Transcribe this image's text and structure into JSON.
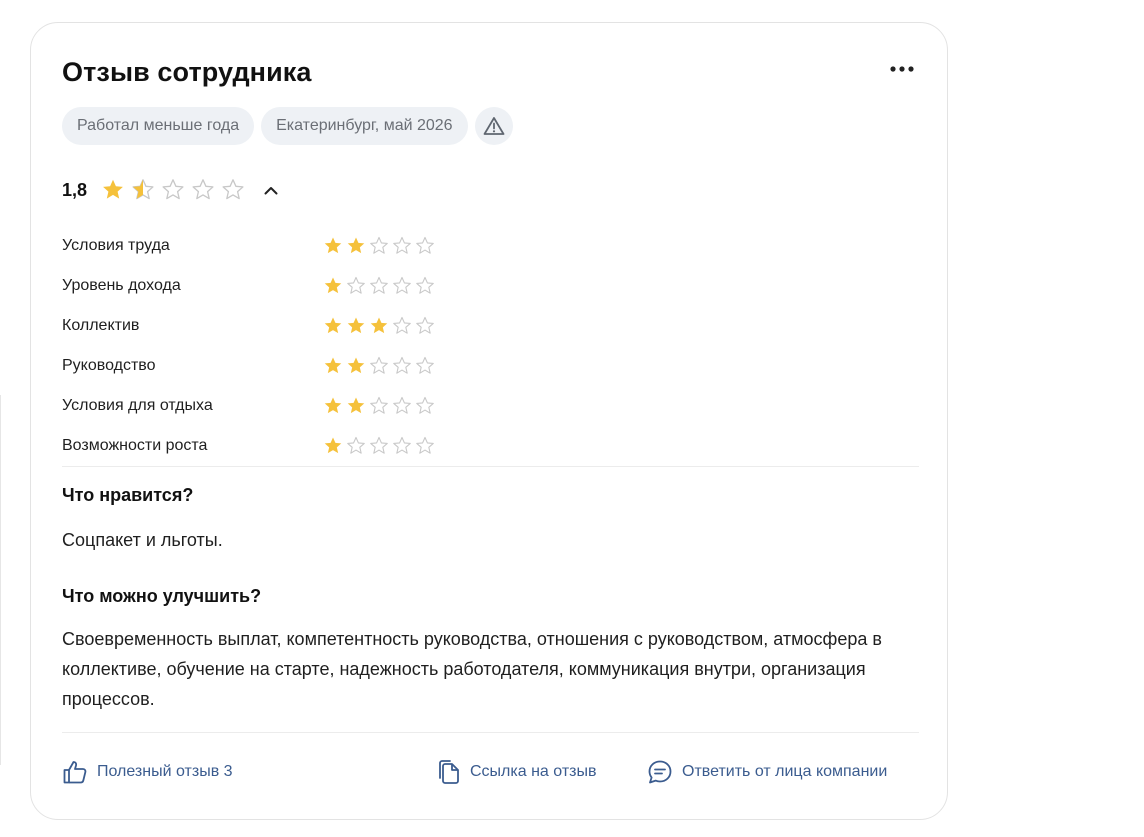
{
  "review": {
    "title": "Отзыв сотрудника",
    "menu_icon": "more-horizontal-icon",
    "chips": {
      "tenure": "Работал меньше года",
      "location_date": "Екатеринбург, май 2026",
      "report_icon": "warning-triangle-icon"
    },
    "overall": {
      "score": "1,8",
      "value": 1.8,
      "max": 5,
      "toggle_icon": "chevron-up-icon"
    },
    "ratings": [
      {
        "label": "Условия труда",
        "value": 2
      },
      {
        "label": "Уровень дохода",
        "value": 1
      },
      {
        "label": "Коллектив",
        "value": 3
      },
      {
        "label": "Руководство",
        "value": 2
      },
      {
        "label": "Условия для отдыха",
        "value": 2
      },
      {
        "label": "Возможности роста",
        "value": 1
      }
    ],
    "likes_heading": "Что нравится?",
    "likes_text": "Соцпакет и льготы.",
    "improve_heading": "Что можно улучшить?",
    "improve_text": "Своевременность выплат, компетентность руководства, отношения с руководством, атмосфера в коллективе, обучение на старте, надежность работодателя, коммуникация внутри, организация процессов.",
    "footer": {
      "helpful_label": "Полезный отзыв 3",
      "helpful_icon": "thumbs-up-icon",
      "link_label": "Ссылка на отзыв",
      "link_icon": "copy-icon",
      "reply_label": "Ответить от лица компании",
      "reply_icon": "chat-bubble-icon"
    },
    "colors": {
      "star_filled": "#f5c13b",
      "star_empty": "#c8c8c8",
      "action": "#3b5c8f",
      "chip_bg": "#eef1f5"
    }
  }
}
